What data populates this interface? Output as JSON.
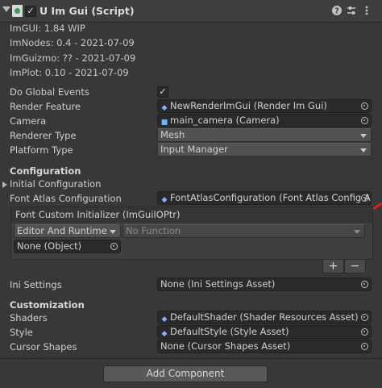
{
  "component": {
    "title": "U Im Gui (Script)",
    "enabled_check": "✓",
    "icons": [
      "help-icon",
      "settings-sliders-icon",
      "more-menu-icon"
    ]
  },
  "versions": [
    "ImGUI: 1.84 WIP",
    "ImNodes: 0.4 - 2021-07-09",
    "ImGuizmo: ?? - 2021-07-09",
    "ImPlot: 0.10 - 2021-07-09"
  ],
  "fields": {
    "global_events": {
      "label": "Do Global Events",
      "checked": "✓"
    },
    "render_feature": {
      "label": "Render Feature",
      "value": "NewRenderImGui (Render Im Gui)"
    },
    "camera": {
      "label": "Camera",
      "value": "main_camera (Camera)"
    },
    "renderer_type": {
      "label": "Renderer Type",
      "value": "Mesh"
    },
    "platform_type": {
      "label": "Platform Type",
      "value": "Input Manager"
    }
  },
  "configuration": {
    "heading": "Configuration",
    "initial_config_label": "Initial Configuration",
    "font_atlas_label": "Font Atlas Configuration",
    "font_atlas_value": "FontAtlasConfiguration (Font Atlas Config Asse"
  },
  "event": {
    "title": "Font Custom Initializer (ImGuiIOPtr)",
    "runtime_option": "Editor And Runtime",
    "function_option": "No Function",
    "object_value": "None (Object)",
    "add_label": "+",
    "remove_label": "−"
  },
  "ini": {
    "label": "Ini Settings",
    "value": "None (Ini Settings Asset)"
  },
  "customization": {
    "heading": "Customization",
    "shaders_label": "Shaders",
    "shaders_value": "DefaultShader (Shader Resources Asset)",
    "style_label": "Style",
    "style_value": "DefaultStyle (Style Asset)",
    "cursor_label": "Cursor Shapes",
    "cursor_value": "None (Cursor Shapes Asset)"
  },
  "add_component_label": "Add Component",
  "colors": {
    "annotation_red": "#e0201b",
    "background": "#383838"
  }
}
